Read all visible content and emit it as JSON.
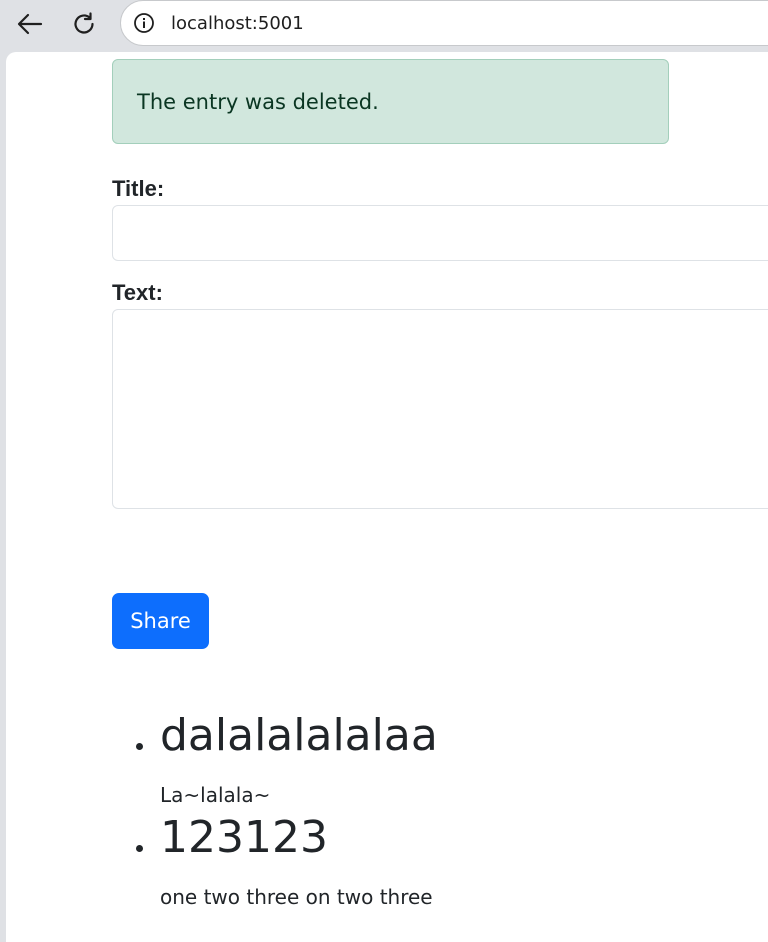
{
  "browser": {
    "url": "localhost:5001"
  },
  "alert": {
    "message": "The entry was deleted."
  },
  "form": {
    "title_label": "Title:",
    "title_value": "",
    "text_label": "Text:",
    "text_value": "",
    "submit_label": "Share"
  },
  "entries": [
    {
      "title": "dalalalalalaa",
      "text": "La~lalala~"
    },
    {
      "title": "123123",
      "text": "one two three on two three"
    }
  ]
}
